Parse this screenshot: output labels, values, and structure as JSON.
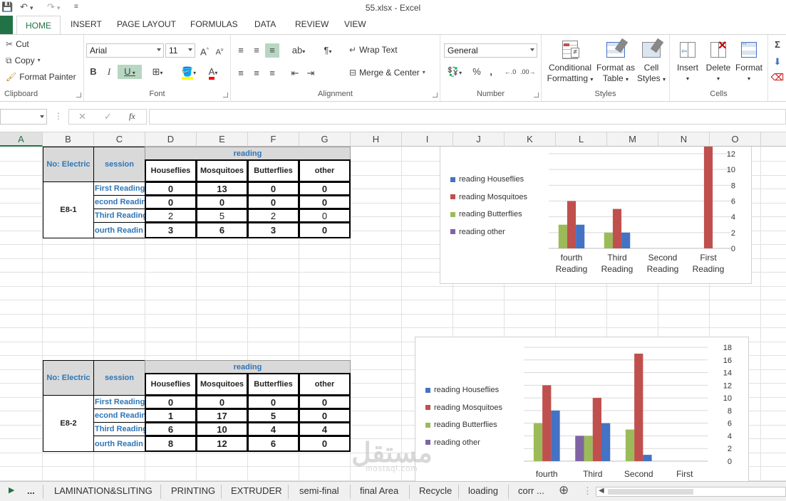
{
  "window": {
    "title": "55.xlsx - Excel"
  },
  "ribbon_tabs": [
    "HOME",
    "INSERT",
    "PAGE LAYOUT",
    "FORMULAS",
    "DATA",
    "REVIEW",
    "VIEW"
  ],
  "ribbon": {
    "clipboard": {
      "label": "Clipboard",
      "cut": "Cut",
      "copy": "Copy",
      "format_painter": "Format Painter"
    },
    "font": {
      "label": "Font",
      "family": "Arial",
      "size": "11",
      "bold": "B",
      "italic": "I",
      "underline": "U"
    },
    "alignment": {
      "label": "Alignment",
      "wrap_text": "Wrap Text",
      "merge_center": "Merge & Center"
    },
    "number": {
      "label": "Number",
      "format": "General",
      "percent": "%",
      "comma": ","
    },
    "styles": {
      "label": "Styles",
      "conditional_1": "Conditional",
      "conditional_2": "Formatting",
      "format_table_1": "Format as",
      "format_table_2": "Table",
      "cell_styles_1": "Cell",
      "cell_styles_2": "Styles"
    },
    "cells": {
      "label": "Cells",
      "insert": "Insert",
      "delete": "Delete",
      "format": "Format"
    }
  },
  "formula_bar": {
    "fx": "fx",
    "cancel": "✕",
    "confirm": "✓",
    "content": ""
  },
  "columns": [
    "A",
    "B",
    "C",
    "D",
    "E",
    "F",
    "G",
    "H",
    "I",
    "J",
    "K",
    "L",
    "M",
    "N",
    "O"
  ],
  "tables": [
    {
      "no_label": "No: Electric",
      "session_label": "session",
      "reading_label": "reading",
      "group": "E8-1",
      "headers": [
        "Houseflies",
        "Mosquitoes",
        "Butterflies",
        "other"
      ],
      "sessions": [
        "First Reading",
        "econd Readin",
        "Third Reading",
        "ourth Readin"
      ],
      "values": [
        [
          "0",
          "13",
          "0",
          "0"
        ],
        [
          "0",
          "0",
          "0",
          "0"
        ],
        [
          "2",
          "5",
          "2",
          "0"
        ],
        [
          "3",
          "6",
          "3",
          "0"
        ]
      ]
    },
    {
      "no_label": "No: Electric",
      "session_label": "session",
      "reading_label": "reading",
      "group": "E8-2",
      "headers": [
        "Houseflies",
        "Mosquitoes",
        "Butterflies",
        "other"
      ],
      "sessions": [
        "First Reading",
        "econd Readin",
        "Third Reading",
        "ourth Readin"
      ],
      "values": [
        [
          "0",
          "0",
          "0",
          "0"
        ],
        [
          "1",
          "17",
          "5",
          "0"
        ],
        [
          "6",
          "10",
          "4",
          "4"
        ],
        [
          "8",
          "12",
          "6",
          "0"
        ]
      ]
    }
  ],
  "chart_data": [
    {
      "type": "bar",
      "categories": [
        "fourth Reading",
        "Third Reading",
        "Second Reading",
        "First Reading"
      ],
      "category_lines": [
        [
          "fourth",
          "Reading"
        ],
        [
          "Third",
          "Reading"
        ],
        [
          "Second",
          "Reading"
        ],
        [
          "First",
          "Reading"
        ]
      ],
      "series": [
        {
          "name": "reading Houseflies",
          "values": [
            3,
            2,
            0,
            0
          ],
          "color": "#4472c4"
        },
        {
          "name": "reading Mosquitoes",
          "values": [
            6,
            5,
            0,
            13
          ],
          "color": "#c0504d"
        },
        {
          "name": "reading Butterflies",
          "values": [
            3,
            2,
            0,
            0
          ],
          "color": "#9bbb59"
        },
        {
          "name": "reading other",
          "values": [
            0,
            0,
            0,
            0
          ],
          "color": "#8064a2"
        }
      ],
      "yticks": [
        "0",
        "2",
        "4",
        "6",
        "8",
        "10",
        "12"
      ],
      "ylim": [
        0,
        12
      ],
      "grid": true,
      "legend": "left",
      "axis_side": "right"
    },
    {
      "type": "bar",
      "categories": [
        "fourth",
        "Third",
        "Second",
        "First"
      ],
      "category_lines": [
        [
          "fourth"
        ],
        [
          "Third"
        ],
        [
          "Second"
        ],
        [
          "First"
        ]
      ],
      "series": [
        {
          "name": "reading Houseflies",
          "values": [
            8,
            6,
            1,
            0
          ],
          "color": "#4472c4"
        },
        {
          "name": "reading Mosquitoes",
          "values": [
            12,
            10,
            17,
            0
          ],
          "color": "#c0504d"
        },
        {
          "name": "reading Butterflies",
          "values": [
            6,
            4,
            5,
            0
          ],
          "color": "#9bbb59"
        },
        {
          "name": "reading other",
          "values": [
            0,
            4,
            0,
            0
          ],
          "color": "#8064a2"
        }
      ],
      "yticks": [
        "0",
        "2",
        "4",
        "6",
        "8",
        "10",
        "12",
        "14",
        "16",
        "18"
      ],
      "ylim": [
        0,
        18
      ],
      "grid": true,
      "legend": "left",
      "axis_side": "right"
    }
  ],
  "watermark": {
    "main": "مستقل",
    "sub": "mostaql.com"
  },
  "sheet_tabs": [
    "...",
    "LAMINATION&SLITING",
    "PRINTING",
    "EXTRUDER",
    "semi-final",
    "final Area",
    "Recycle",
    "loading",
    "corr ..."
  ]
}
